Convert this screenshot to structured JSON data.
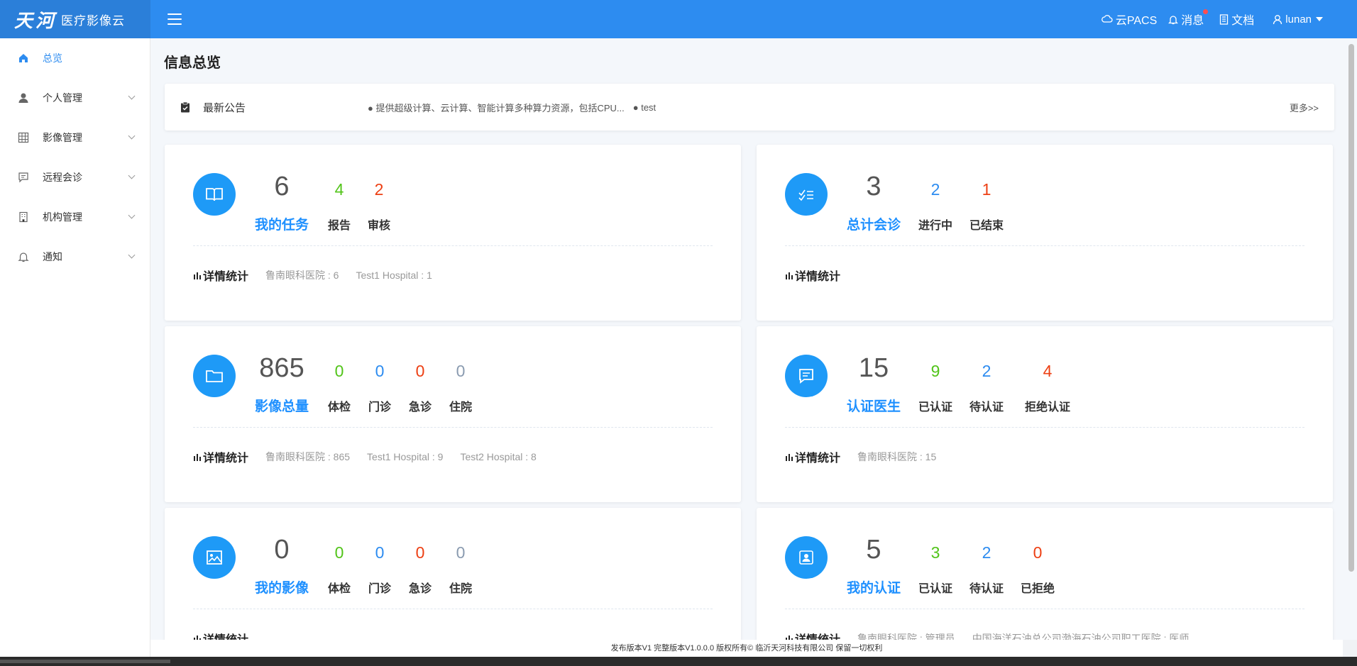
{
  "header": {
    "logo_big": "天河",
    "logo_small": "医疗影像云",
    "cloud_pacs": "云PACS",
    "messages": "消息",
    "docs": "文档",
    "username": "lunan"
  },
  "sidebar": {
    "items": [
      {
        "label": "总览",
        "icon": "home-icon",
        "active": true
      },
      {
        "label": "个人管理",
        "icon": "user-icon"
      },
      {
        "label": "影像管理",
        "icon": "grid-icon"
      },
      {
        "label": "远程会诊",
        "icon": "chat-icon"
      },
      {
        "label": "机构管理",
        "icon": "building-icon"
      },
      {
        "label": "通知",
        "icon": "bell-icon"
      }
    ]
  },
  "page": {
    "title": "信息总览"
  },
  "notice": {
    "title": "最新公告",
    "items": [
      "● 提供超级计算、云计算、智能计算多种算力资源，包括CPU...",
      "● test"
    ],
    "more": "更多>>"
  },
  "cards": {
    "tasks": {
      "total": "6",
      "label": "我的任务",
      "subs": [
        {
          "value": "4",
          "label": "报告"
        },
        {
          "value": "2",
          "label": "审核"
        }
      ],
      "detail_title": "详情统计",
      "stats": [
        "鲁南眼科医院 : 6",
        "Test1 Hospital : 1"
      ]
    },
    "consult": {
      "total": "3",
      "label": "总计会诊",
      "subs": [
        {
          "value": "2",
          "label": "进行中"
        },
        {
          "value": "1",
          "label": "已结束"
        }
      ],
      "detail_title": "详情统计",
      "stats": []
    },
    "images": {
      "total": "865",
      "label": "影像总量",
      "subs": [
        {
          "value": "0",
          "label": "体检"
        },
        {
          "value": "0",
          "label": "门诊"
        },
        {
          "value": "0",
          "label": "急诊"
        },
        {
          "value": "0",
          "label": "住院"
        }
      ],
      "detail_title": "详情统计",
      "stats": [
        "鲁南眼科医院 : 865",
        "Test1 Hospital : 9",
        "Test2 Hospital : 8"
      ]
    },
    "doctors": {
      "total": "15",
      "label": "认证医生",
      "subs": [
        {
          "value": "9",
          "label": "已认证"
        },
        {
          "value": "2",
          "label": "待认证"
        },
        {
          "value": "4",
          "label": "拒绝认证"
        }
      ],
      "detail_title": "详情统计",
      "stats": [
        "鲁南眼科医院 : 15"
      ]
    },
    "myimages": {
      "total": "0",
      "label": "我的影像",
      "subs": [
        {
          "value": "0",
          "label": "体检"
        },
        {
          "value": "0",
          "label": "门诊"
        },
        {
          "value": "0",
          "label": "急诊"
        },
        {
          "value": "0",
          "label": "住院"
        }
      ],
      "detail_title": "详情统计"
    },
    "mycert": {
      "total": "5",
      "label": "我的认证",
      "subs": [
        {
          "value": "3",
          "label": "已认证"
        },
        {
          "value": "2",
          "label": "待认证"
        },
        {
          "value": "0",
          "label": "已拒绝"
        }
      ],
      "detail_title": "详情统计",
      "stats": [
        "鲁南眼科医院 : 管理员",
        "中国海洋石油总公司渤海石油公司职工医院 : 医师"
      ]
    }
  },
  "footer": {
    "text": "发布版本V1 完整版本V1.0.0.0 版权所有© 临沂天河科技有限公司 保留一切权利"
  },
  "colors": {
    "primary": "#2d8cf0",
    "icon_circle": "#1e9af7",
    "green": "#52c41a",
    "red": "#ed4014",
    "gray": "#8a9bb0"
  }
}
